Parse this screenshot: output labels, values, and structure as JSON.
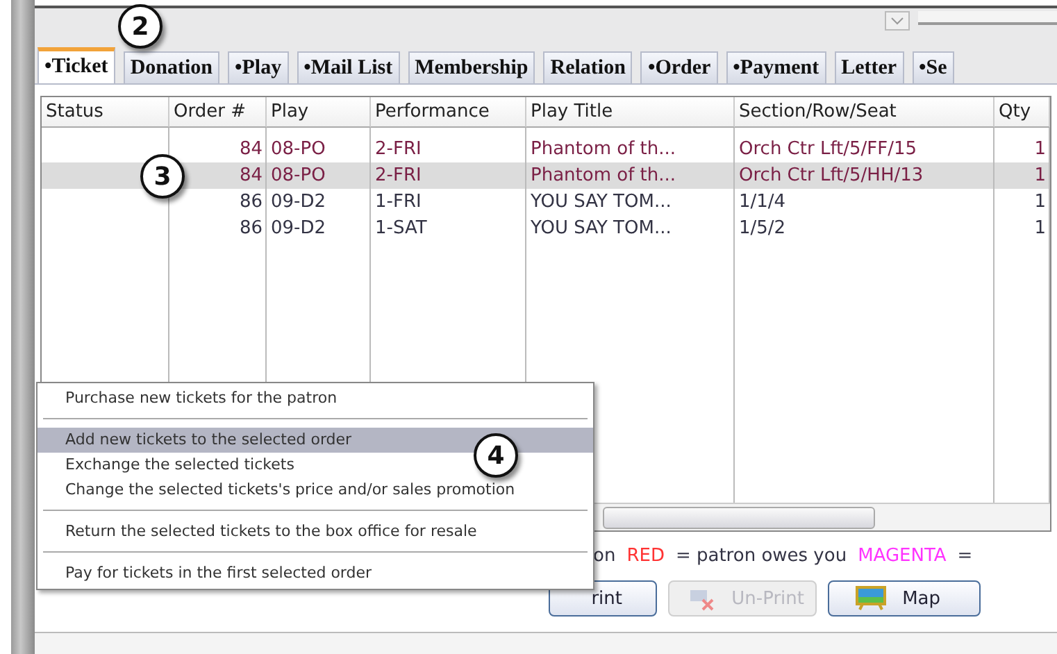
{
  "tabs": [
    {
      "label": "•Ticket",
      "selected": true
    },
    {
      "label": "Donation",
      "selected": false
    },
    {
      "label": "•Play",
      "selected": false
    },
    {
      "label": "•Mail List",
      "selected": false
    },
    {
      "label": "Membership",
      "selected": false
    },
    {
      "label": "Relation",
      "selected": false
    },
    {
      "label": "•Order",
      "selected": false
    },
    {
      "label": "•Payment",
      "selected": false
    },
    {
      "label": "Letter",
      "selected": false
    },
    {
      "label": "•Se",
      "selected": false
    }
  ],
  "table": {
    "columns": [
      "Status",
      "Order #",
      "Play",
      "Performance",
      "Play Title",
      "Section/Row/Seat",
      "Qty"
    ],
    "rows": [
      {
        "selected": false,
        "color": "#7a1f45",
        "cells": [
          "",
          "84",
          "08-PO",
          "2-FRI",
          "Phantom of th...",
          "Orch Ctr Lft/5/FF/15",
          "1"
        ]
      },
      {
        "selected": true,
        "color": "#7a1f45",
        "cells": [
          "",
          "84",
          "08-PO",
          "2-FRI",
          "Phantom of th...",
          "Orch Ctr Lft/5/HH/13",
          "1"
        ]
      },
      {
        "selected": false,
        "color": "#333344",
        "cells": [
          "",
          "86",
          "09-D2",
          "1-FRI",
          "YOU SAY TOM...",
          "1/1/4",
          "1"
        ]
      },
      {
        "selected": false,
        "color": "#333344",
        "cells": [
          "",
          "86",
          "09-D2",
          "1-SAT",
          "YOU SAY TOM...",
          "1/5/2",
          "1"
        ]
      }
    ]
  },
  "legend": [
    {
      "text": "on",
      "color": "#333344"
    },
    {
      "text": "RED",
      "color": "#ff3333"
    },
    {
      "text": "= patron owes you",
      "color": "#333344"
    },
    {
      "text": "MAGENTA",
      "color": "#ff33ff"
    },
    {
      "text": "=",
      "color": "#333344"
    }
  ],
  "buttons": [
    {
      "label": "rint",
      "disabled": false,
      "kind": "plain"
    },
    {
      "label": "Un-Print",
      "disabled": true,
      "kind": "unprint"
    },
    {
      "label": "Map",
      "disabled": false,
      "kind": "map"
    }
  ],
  "menu": {
    "groups": [
      [
        {
          "label": "Purchase new tickets for the patron",
          "selected": false
        }
      ],
      [
        {
          "label": "Add new tickets to the selected order",
          "selected": true
        },
        {
          "label": "Exchange the selected tickets",
          "selected": false
        },
        {
          "label": "Change the selected tickets's price and/or sales promotion",
          "selected": false
        }
      ],
      [
        {
          "label": "Return the selected tickets to the box office for resale",
          "selected": false
        }
      ],
      [
        {
          "label": "Pay for tickets in the first selected order",
          "selected": false
        }
      ]
    ]
  },
  "callouts": [
    "2",
    "3",
    "4"
  ]
}
